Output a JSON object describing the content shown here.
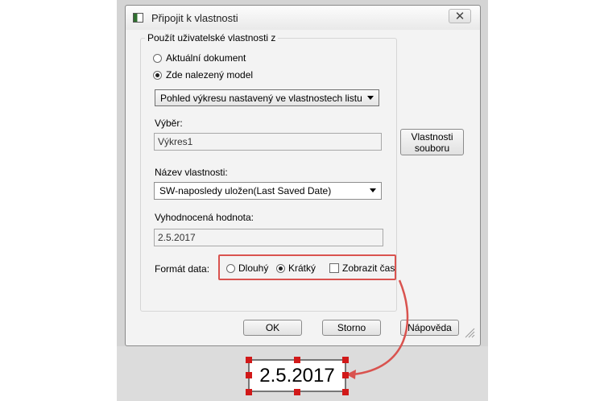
{
  "dialog": {
    "title": "Připojit k vlastnosti",
    "close_icon": "close-icon",
    "group_label": "Použít uživatelské vlastnosti z",
    "source_options": [
      {
        "label": "Aktuální dokument",
        "checked": false
      },
      {
        "label": "Zde nalezený model",
        "checked": true
      }
    ],
    "view_combo": "Pohled výkresu nastavený ve vlastnostech listu",
    "selection_label": "Výběr:",
    "selection_value": "Výkres1",
    "property_button": "Vlastnosti souboru",
    "property_name_label": "Název vlastnosti:",
    "property_name_value": "SW-naposledy uložen(Last Saved Date)",
    "evaluated_label": "Vyhodnocená hodnota:",
    "evaluated_value": "2.5.2017",
    "date_format_label": "Formát data:",
    "date_format_options": [
      {
        "label": "Dlouhý",
        "checked": false
      },
      {
        "label": "Krátký",
        "checked": true
      }
    ],
    "show_time_label": "Zobrazit čas",
    "show_time_checked": false,
    "ok": "OK",
    "cancel": "Storno",
    "help": "Nápověda"
  },
  "note": {
    "text": "2.5.2017"
  },
  "colors": {
    "highlight": "#d9534f",
    "handles": "#d11919"
  }
}
